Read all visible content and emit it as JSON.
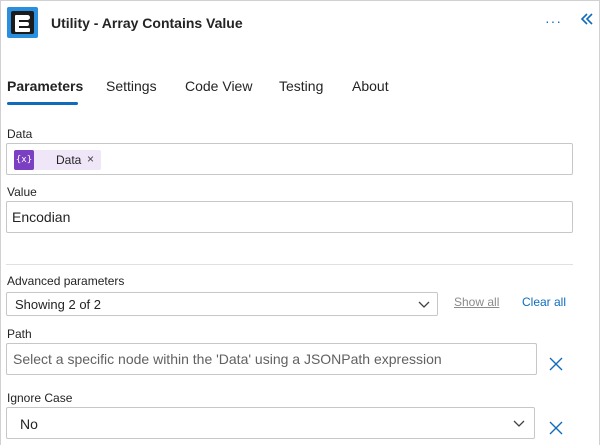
{
  "header": {
    "title": "Utility - Array Contains Value",
    "more_glyph": "···",
    "colors": {
      "accent": "#0f6cbd",
      "app_icon_bg": "#2b8fe0"
    }
  },
  "tabs": [
    {
      "label": "Parameters",
      "active": true
    },
    {
      "label": "Settings",
      "active": false
    },
    {
      "label": "Code View",
      "active": false
    },
    {
      "label": "Testing",
      "active": false
    },
    {
      "label": "About",
      "active": false
    }
  ],
  "fields": {
    "data": {
      "label": "Data",
      "token_label": "Data",
      "token_icon_text": "{x}",
      "remove_glyph": "×"
    },
    "value": {
      "label": "Value",
      "value": "Encodian"
    },
    "advanced": {
      "label": "Advanced parameters",
      "selected": "Showing 2 of 2",
      "show_all": "Show all",
      "clear_all": "Clear all"
    },
    "path": {
      "label": "Path",
      "placeholder": "Select a specific node within the 'Data' using a JSONPath expression"
    },
    "ignore_case": {
      "label": "Ignore Case",
      "selected": "No"
    }
  },
  "icons": {
    "app": "encodian-logo-icon",
    "more": "more-horizontal-icon",
    "collapse": "chevron-double-left-icon",
    "token": "variable-icon",
    "dropdown": "chevron-down-icon",
    "clear": "close-icon"
  }
}
